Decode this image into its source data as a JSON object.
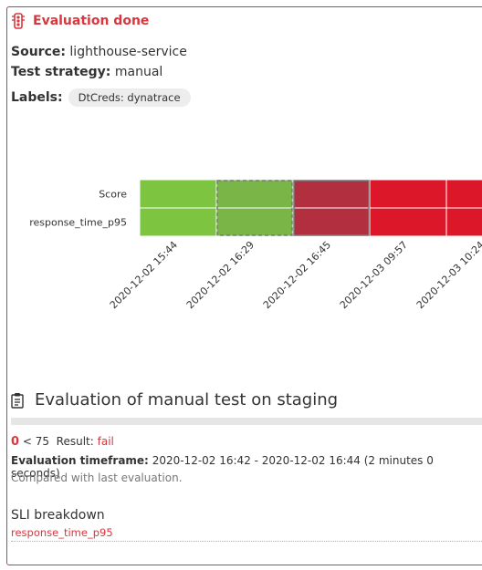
{
  "header": {
    "title": "Evaluation done",
    "icon": "traffic-light-icon",
    "color": "#d9363e"
  },
  "source": {
    "label": "Source:",
    "value": "lighthouse-service"
  },
  "strategy": {
    "label": "Test strategy:",
    "value": "manual"
  },
  "labels": {
    "label": "Labels:",
    "chips": [
      "DtCreds: dynatrace"
    ]
  },
  "chart_data": {
    "type": "heatmap",
    "rows": [
      "Score",
      "response_time_p95"
    ],
    "columns": [
      "2020-12-02 15:44",
      "2020-12-02 16:29",
      "2020-12-02 16:45",
      "2020-12-03 09:57",
      "2020-12-03 10:24"
    ],
    "status": [
      "pass",
      "pass",
      "fail",
      "fail",
      "fail"
    ],
    "selected_columns": [
      "2020-12-02 16:29",
      "2020-12-02 16:45"
    ],
    "colors": {
      "pass": "#7dc540",
      "pass_selected": "#7ab547",
      "fail": "#dc172a",
      "fail_selected": "#b22f40"
    }
  },
  "evaluation": {
    "icon": "clipboard-icon",
    "title": "Evaluation of manual test on staging",
    "score": "0",
    "threshold": "< 75",
    "result_label": "Result:",
    "result_value": "fail",
    "timeframe_label": "Evaluation timeframe:",
    "timeframe_value": "2020-12-02 16:42 - 2020-12-02 16:44 (2 minutes 0 seconds)",
    "compared": "Compared with last evaluation."
  },
  "sli": {
    "title": "SLI breakdown",
    "items": [
      "response_time_p95"
    ]
  }
}
